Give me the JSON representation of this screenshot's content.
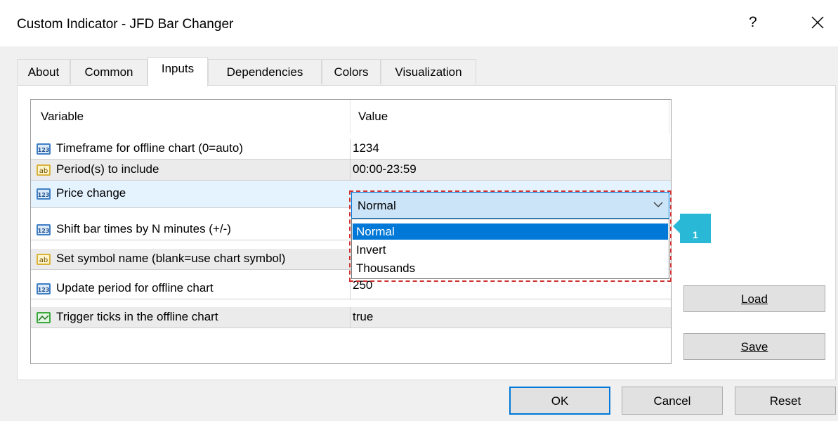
{
  "window": {
    "title": "Custom Indicator - JFD Bar Changer",
    "help_label": "?",
    "close_label": "×"
  },
  "tabs": [
    {
      "label": "About"
    },
    {
      "label": "Common"
    },
    {
      "label": "Inputs",
      "active": true
    },
    {
      "label": "Dependencies"
    },
    {
      "label": "Colors"
    },
    {
      "label": "Visualization"
    }
  ],
  "grid": {
    "headers": {
      "variable": "Variable",
      "value": "Value"
    },
    "rows": [
      {
        "icon": "numeric-123-icon",
        "variable": "Timeframe for offline chart (0=auto)",
        "value": "1234"
      },
      {
        "icon": "text-ab-icon",
        "variable": "Period(s) to include",
        "value": "00:00-23:59"
      },
      {
        "icon": "numeric-123-icon",
        "variable": "Price change",
        "value": "Normal"
      },
      {
        "icon": "numeric-123-icon",
        "variable": "Shift bar times by N minutes (+/-)",
        "value": ""
      },
      {
        "icon": "text-ab-icon",
        "variable": "Set symbol name (blank=use chart symbol)",
        "value": ""
      },
      {
        "icon": "numeric-123-icon",
        "variable": "Update period for offline chart",
        "value": "250"
      },
      {
        "icon": "boolean-chart-icon",
        "variable": "Trigger ticks in the offline chart",
        "value": "true"
      }
    ]
  },
  "combo": {
    "selected": "Normal",
    "options": [
      "Normal",
      "Invert",
      "Thousands"
    ]
  },
  "callout": {
    "number": "1"
  },
  "side_buttons": {
    "load": "Load",
    "save": "Save"
  },
  "footer": {
    "ok": "OK",
    "cancel": "Cancel",
    "reset": "Reset"
  },
  "colors": {
    "accent": "#0078d7",
    "selection_row": "#e5f3ff",
    "highlight_border": "#d03030",
    "callout_bg": "#29b8d6"
  }
}
